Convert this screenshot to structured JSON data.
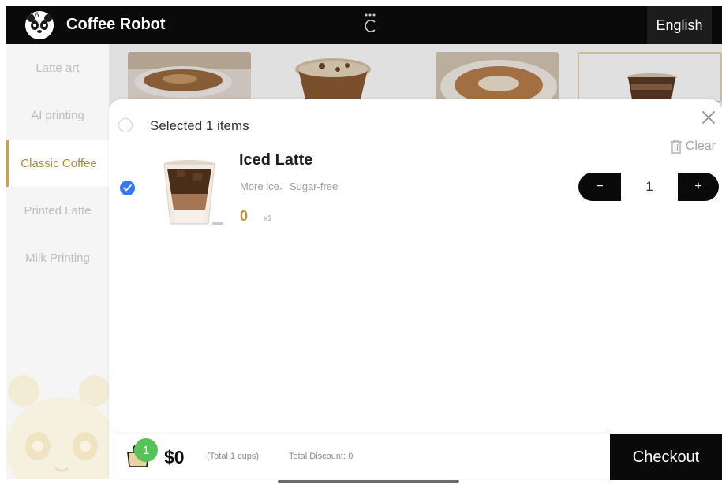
{
  "header": {
    "title": "Coffee Robot",
    "logo_badge": "16",
    "language_button": "English",
    "bg_color": "#0a0a0a"
  },
  "sidebar": {
    "items": [
      {
        "label": "Latte art",
        "active": false
      },
      {
        "label": "AI printing",
        "active": false
      },
      {
        "label": "Classic Coffee",
        "active": true
      },
      {
        "label": "Printed Latte",
        "active": false
      },
      {
        "label": "Milk Printing",
        "active": false
      }
    ],
    "accent_color": "#b08a3a"
  },
  "cart_sheet": {
    "select_label": "Selected 1 items",
    "clear_label": "Clear",
    "items": [
      {
        "name": "Iced Latte",
        "options": "More ice、Sugar-free",
        "price": "0",
        "qty_multiplier": "x1",
        "quantity": "1",
        "checked": true
      }
    ],
    "stepper": {
      "minus": "−",
      "plus": "+"
    }
  },
  "bottom_bar": {
    "cart_count": "1",
    "total": "$0",
    "cups_note": "(Total 1 cups)",
    "discount_note": "Total Discount: 0",
    "checkout_label": "Checkout"
  },
  "colors": {
    "check_blue": "#3478f6",
    "price_gold": "#b8913c",
    "badge_green": "#57c257"
  },
  "icons": [
    "panda-logo-icon",
    "loading-spinner-icon",
    "close-icon",
    "trash-icon",
    "checkmark-icon",
    "cart-icon"
  ]
}
